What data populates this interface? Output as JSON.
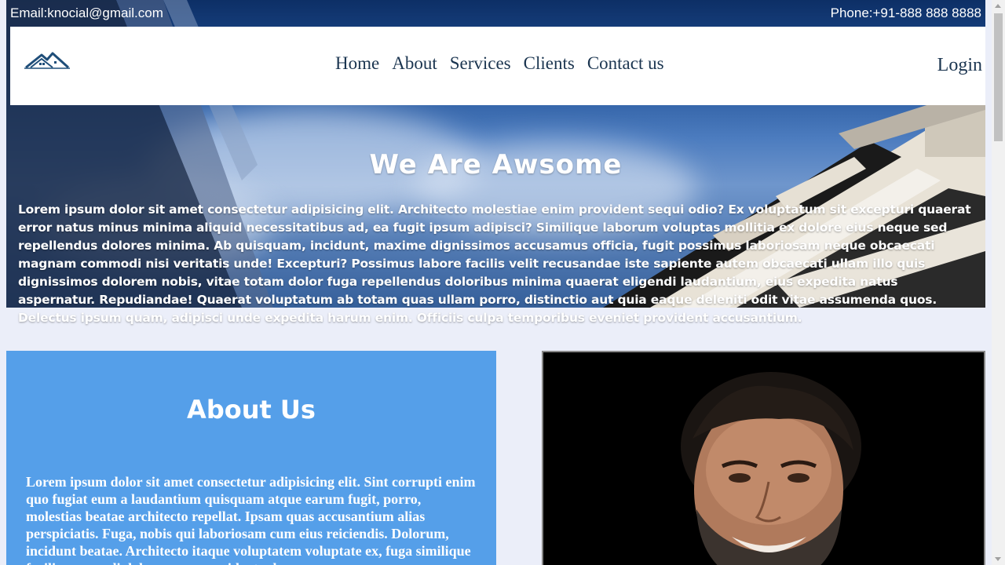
{
  "topbar": {
    "email": "Email:knocial@gmail.com",
    "phone": "Phone:+91-888 888 8888"
  },
  "nav": {
    "logo_icon": "house-roof-logo",
    "items": [
      "Home",
      "About",
      "Services",
      "Clients",
      "Contact us"
    ],
    "login": "Login"
  },
  "hero": {
    "title": "We Are Awsome",
    "text": "Lorem ipsum dolor sit amet consectetur adipisicing elit. Architecto molestiae enim provident sequi odio? Ex voluptatum sit excepturi quaerat error natus minus minima aliquid necessitatibus ad, ea fugit ipsum adipisci? Similique laborum voluptas mollitia ex dolore eius neque sed repellendus dolores minima. Ab quisquam, incidunt, maxime dignissimos accusamus officia, fugit possimus laboriosam neque obcaecati magnam commodi nisi veritatis unde! Excepturi? Possimus labore facilis velit recusandae iste sapiente autem obcaecati ullam illo quis dignissimos dolorem nobis, vitae totam dolor fuga repellendus doloribus minima quaerat eligendi laudantium, eius expedita natus aspernatur. Repudiandae! Quaerat voluptatum ab totam quas ullam porro, distinctio aut quia eaque deleniti odit vitae assumenda quos. Delectus ipsum quam, adipisci unde expedita harum enim. Officiis culpa temporibus eveniet provident accusantium."
  },
  "about": {
    "title": "About Us",
    "text": "Lorem ipsum dolor sit amet consectetur adipisicing elit. Sint corrupti enim quo fugiat eum a laudantium quisquam atque earum fugit, porro, molestias beatae architecto repellat. Ipsam quas accusantium alias perspiciatis. Fuga, nobis qui laboriosam cum eius reiciendis. Dolorum, incidunt beatae. Architecto itaque voluptatem voluptate ex, fuga similique facilis commodi doloremque provident ad..."
  },
  "colors": {
    "about_bg": "#559fe9",
    "page_bg": "#ebeef9",
    "nav_text": "#1b3550"
  }
}
